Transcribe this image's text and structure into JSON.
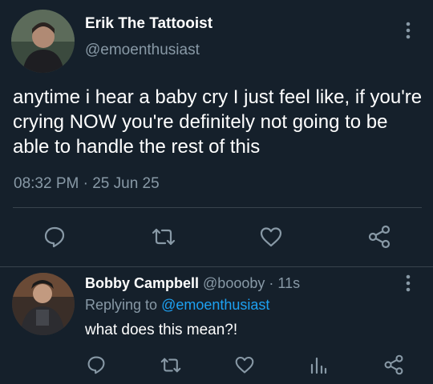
{
  "main_tweet": {
    "author_name": "Erik The Tattooist",
    "author_handle": "@emoenthusiast",
    "text": "anytime i hear a baby cry I just feel like, if you're crying NOW you're definitely not going to be able to handle the rest of this",
    "timestamp": "08:32 PM · 25 Jun 25",
    "icons": [
      "reply-icon",
      "retweet-icon",
      "like-icon",
      "share-icon"
    ]
  },
  "reply": {
    "author_name": "Bobby Campbell",
    "author_handle": "@boooby",
    "time_sep": "·",
    "time": "11s",
    "replying_label": "Replying to",
    "replying_to": "@emoenthusiast",
    "text": "what does this mean?!",
    "icons": [
      "reply-icon",
      "retweet-icon",
      "like-icon",
      "analytics-icon",
      "share-icon"
    ]
  },
  "colors": {
    "background": "#15202b",
    "text": "#ffffff",
    "muted": "#8899a6",
    "accent": "#1da1f2",
    "divider": "#38444d"
  }
}
